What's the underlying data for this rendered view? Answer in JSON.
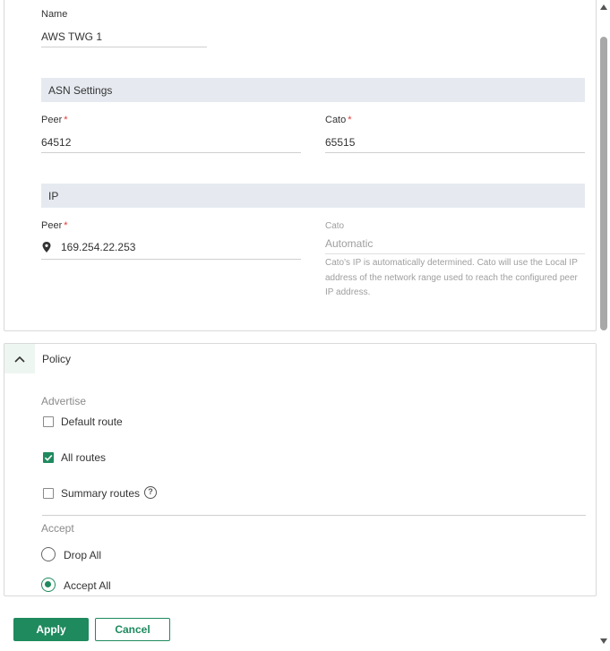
{
  "name": {
    "label": "Name",
    "value": "AWS TWG 1"
  },
  "asn": {
    "section_title": "ASN Settings",
    "peer_label": "Peer",
    "peer_value": "64512",
    "cato_label": "Cato",
    "cato_value": "65515",
    "required_mark": "*"
  },
  "ip": {
    "section_title": "IP",
    "peer_label": "Peer",
    "peer_value": "169.254.22.253",
    "peer_icon": "location-pin-icon",
    "cato_label": "Cato",
    "cato_value": "Automatic",
    "help_text": "Cato's IP is automatically determined. Cato will use the Local IP address of the network range used to reach the configured peer IP address.",
    "required_mark": "*"
  },
  "policy": {
    "title": "Policy",
    "toggle_icon": "chevron-up-icon",
    "advertise_label": "Advertise",
    "advertise_options": [
      {
        "label": "Default route",
        "checked": false
      },
      {
        "label": "All routes",
        "checked": true
      },
      {
        "label": "Summary routes",
        "checked": false
      }
    ],
    "help_glyph": "?",
    "accept_label": "Accept",
    "accept_options": [
      {
        "label": "Drop All",
        "selected": false
      },
      {
        "label": "Accept All",
        "selected": true
      }
    ]
  },
  "actions": {
    "apply_label": "Apply",
    "cancel_label": "Cancel"
  },
  "colors": {
    "accent": "#1e8a5e",
    "section_bg": "#e6eaf0",
    "required": "#e53935"
  }
}
